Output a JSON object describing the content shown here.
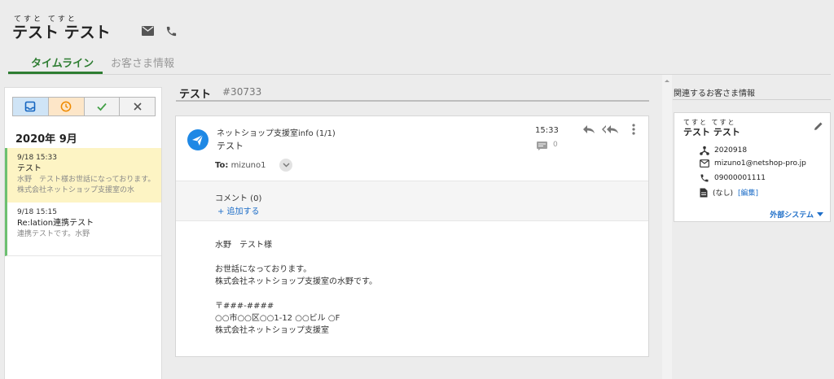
{
  "customer": {
    "ruby": "てすと てすと",
    "name": "テスト テスト"
  },
  "tabs": [
    {
      "label": "タイムライン"
    },
    {
      "label": "お客さま情報"
    }
  ],
  "timeline": {
    "month": "2020年 9月",
    "items": [
      {
        "date": "9/18 15:33",
        "title": "テスト",
        "preview": "水野　テスト様お世話になっております。株式会社ネットショップ支援室の水"
      },
      {
        "date": "9/18 15:15",
        "title": "Re:lation連携テスト",
        "preview": "連携テストです。水野"
      }
    ]
  },
  "ticket": {
    "title": "テスト",
    "number": "#30733"
  },
  "message": {
    "sender": "ネットショップ支援室info (1/1)",
    "subject": "テスト",
    "to_label": "To:",
    "to_value": "mizuno1",
    "time": "15:33",
    "comment_count": "0",
    "comments_label": "コメント (0)",
    "add_label": "+ 追加する",
    "body": [
      "水野　テスト様",
      "",
      "お世話になっております。",
      "株式会社ネットショップ支援室の水野です。",
      "",
      "〒###-####",
      "○○市○○区○○1-12 ○○ビル ○F",
      "株式会社ネットショップ支援室"
    ]
  },
  "related": {
    "title": "関連するお客さま情報",
    "ruby": "てすと てすと",
    "name": "テスト テスト",
    "id": "2020918",
    "email": "mizuno1@netshop-pro.jp",
    "phone": "09000001111",
    "note": "(なし)",
    "edit": "[編集]",
    "external": "外部システム"
  },
  "colors": {
    "accent_green": "#2e7d32",
    "link_blue": "#1e6ec8",
    "selected_bg": "#fdf4c4",
    "send_icon_blue": "#1e88e5"
  },
  "icons": [
    "mail-icon",
    "phone-icon",
    "inbox-icon",
    "clock-icon",
    "check-icon",
    "close-icon",
    "send-icon",
    "reply-icon",
    "reply-all-icon",
    "more-vert-icon",
    "comment-icon",
    "chevron-down-icon",
    "plus-icon",
    "edit-icon",
    "id-icon",
    "email-icon",
    "file-icon"
  ]
}
